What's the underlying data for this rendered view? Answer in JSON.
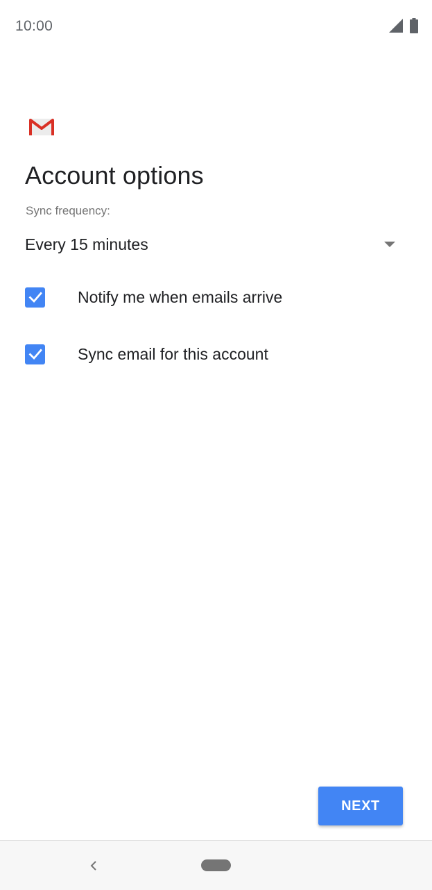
{
  "status_bar": {
    "time": "10:00",
    "icons": [
      "signal-icon",
      "battery-icon"
    ]
  },
  "app": {
    "logo": "gmail-logo-icon"
  },
  "page": {
    "title": "Account options"
  },
  "sync_frequency": {
    "label": "Sync frequency:",
    "selected": "Every 15 minutes",
    "icon": "dropdown-arrow-icon"
  },
  "options": [
    {
      "label": "Notify me when emails arrive",
      "checked": true
    },
    {
      "label": "Sync email for this account",
      "checked": true
    }
  ],
  "actions": {
    "next_label": "NEXT"
  },
  "nav_bar": {
    "icons": [
      "back-icon",
      "home-pill"
    ]
  },
  "colors": {
    "accent": "#4285f4",
    "gmail_red": "#d93025",
    "text_primary": "#202124",
    "text_secondary": "#757575"
  }
}
